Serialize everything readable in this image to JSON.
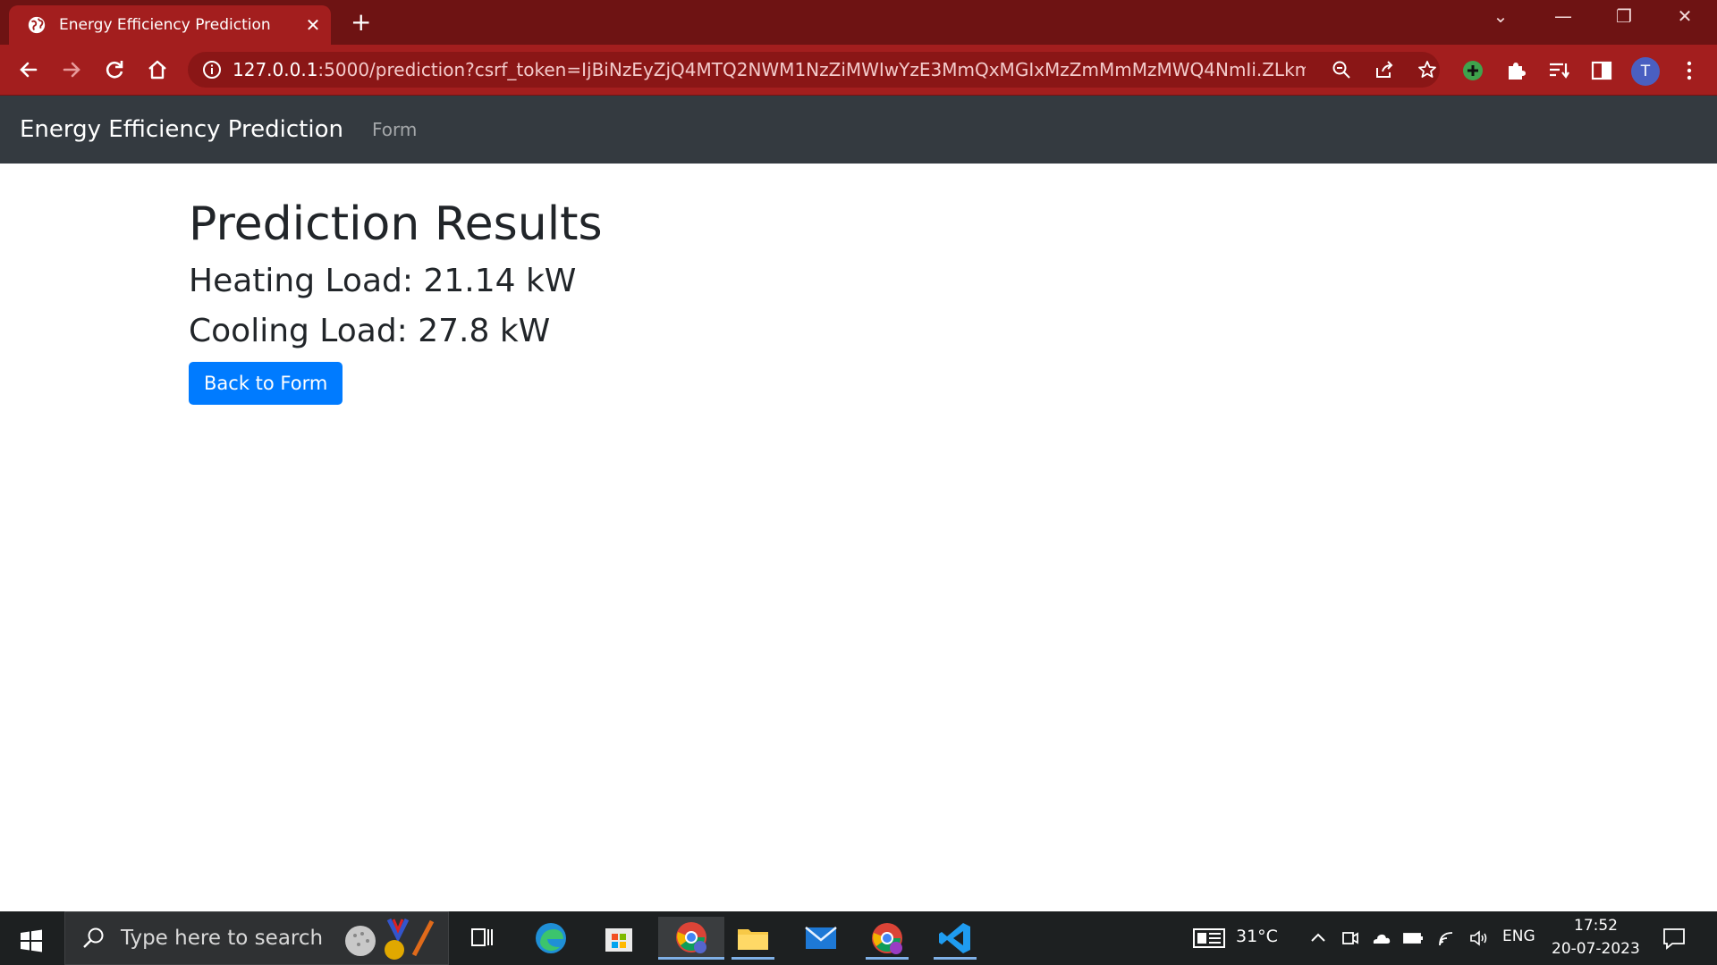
{
  "browser": {
    "tab_title": "Energy Efficiency Prediction",
    "tab_close": "✕",
    "new_tab": "+",
    "url_host": "127.0.0.1",
    "url_rest": ":5000/prediction?csrf_token=IjBiNzEyZjQ4MTQ2NWM1NzZiMWIwYzE3MmQxMGIxMzZmMmMzMWQ4NmIi.ZLkm4g.L...",
    "profile_initial": "T",
    "window_controls": {
      "minimize": "—",
      "restore": "❐",
      "close": "✕",
      "tab_list": "⌄"
    }
  },
  "navbar": {
    "brand": "Energy Efficiency Prediction",
    "links": [
      "Form"
    ]
  },
  "main": {
    "title": "Prediction Results",
    "heating_load": "Heating Load: 21.14 kW",
    "cooling_load": "Cooling Load: 27.8 kW",
    "back_button": "Back to Form"
  },
  "taskbar": {
    "search_placeholder": "Type here to search",
    "weather": "31°C",
    "language": "ENG",
    "time": "17:52",
    "date": "20-07-2023"
  }
}
